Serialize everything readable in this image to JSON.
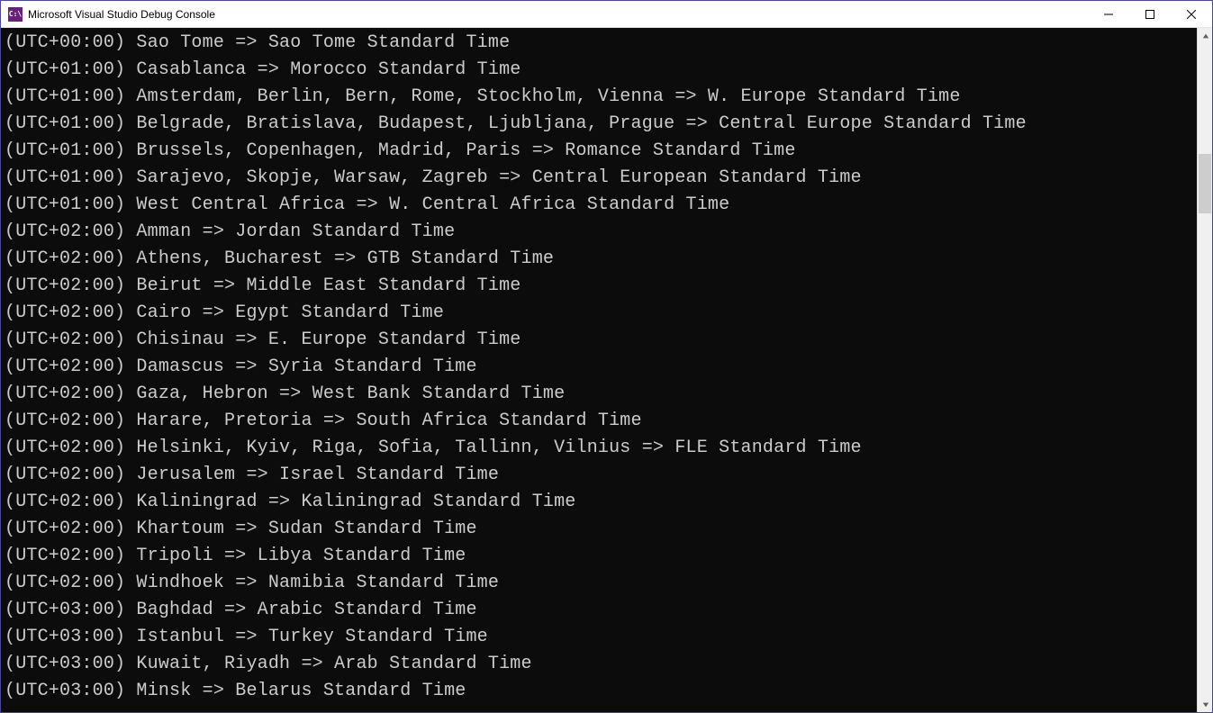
{
  "window": {
    "icon_label": "C:\\",
    "title": "Microsoft Visual Studio Debug Console"
  },
  "scrollbar": {
    "thumb_top_pct": 17,
    "thumb_height_pct": 9
  },
  "console": {
    "lines": [
      "(UTC+00:00) Sao Tome => Sao Tome Standard Time",
      "(UTC+01:00) Casablanca => Morocco Standard Time",
      "(UTC+01:00) Amsterdam, Berlin, Bern, Rome, Stockholm, Vienna => W. Europe Standard Time",
      "(UTC+01:00) Belgrade, Bratislava, Budapest, Ljubljana, Prague => Central Europe Standard Time",
      "(UTC+01:00) Brussels, Copenhagen, Madrid, Paris => Romance Standard Time",
      "(UTC+01:00) Sarajevo, Skopje, Warsaw, Zagreb => Central European Standard Time",
      "(UTC+01:00) West Central Africa => W. Central Africa Standard Time",
      "(UTC+02:00) Amman => Jordan Standard Time",
      "(UTC+02:00) Athens, Bucharest => GTB Standard Time",
      "(UTC+02:00) Beirut => Middle East Standard Time",
      "(UTC+02:00) Cairo => Egypt Standard Time",
      "(UTC+02:00) Chisinau => E. Europe Standard Time",
      "(UTC+02:00) Damascus => Syria Standard Time",
      "(UTC+02:00) Gaza, Hebron => West Bank Standard Time",
      "(UTC+02:00) Harare, Pretoria => South Africa Standard Time",
      "(UTC+02:00) Helsinki, Kyiv, Riga, Sofia, Tallinn, Vilnius => FLE Standard Time",
      "(UTC+02:00) Jerusalem => Israel Standard Time",
      "(UTC+02:00) Kaliningrad => Kaliningrad Standard Time",
      "(UTC+02:00) Khartoum => Sudan Standard Time",
      "(UTC+02:00) Tripoli => Libya Standard Time",
      "(UTC+02:00) Windhoek => Namibia Standard Time",
      "(UTC+03:00) Baghdad => Arabic Standard Time",
      "(UTC+03:00) Istanbul => Turkey Standard Time",
      "(UTC+03:00) Kuwait, Riyadh => Arab Standard Time",
      "(UTC+03:00) Minsk => Belarus Standard Time"
    ]
  }
}
